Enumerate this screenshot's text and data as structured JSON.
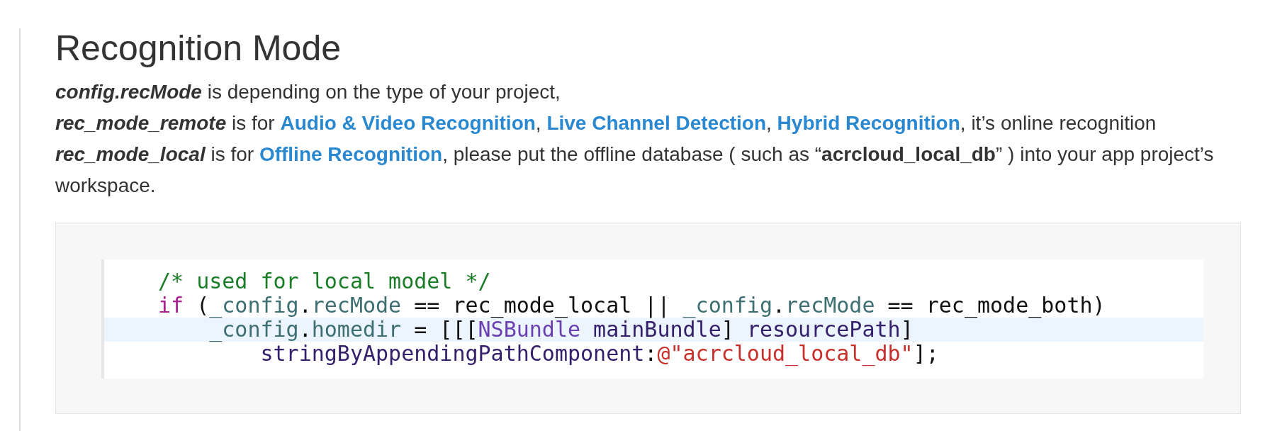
{
  "heading": "Recognition Mode",
  "paragraph_lines": [
    [
      {
        "kind": "term",
        "text": "config.recMode"
      },
      {
        "kind": "text",
        "text": " is depending on the type of your project,"
      }
    ],
    [
      {
        "kind": "term",
        "text": "rec_mode_remote"
      },
      {
        "kind": "text",
        "text": " is for "
      },
      {
        "kind": "link",
        "text": "Audio & Video Recognition",
        "after": ", "
      },
      {
        "kind": "link",
        "text": "Live Channel Detection",
        "after": ", "
      },
      {
        "kind": "link",
        "text": "Hybrid Recognition"
      },
      {
        "kind": "text",
        "text": ", it’s online recognition"
      }
    ],
    [
      {
        "kind": "term",
        "text": "rec_mode_local"
      },
      {
        "kind": "text",
        "text": "  is for "
      },
      {
        "kind": "link",
        "text": "Offline Recognition"
      },
      {
        "kind": "text",
        "text": ", please put the offline database ( such as “**acrcloud_local_db**” ) into your app project’s workspace."
      }
    ]
  ],
  "code_lines": [
    {
      "highlighted": false,
      "tokens": [
        {
          "kind": "comment",
          "text": "/* used for local model */"
        }
      ]
    },
    {
      "highlighted": false,
      "tokens": [
        {
          "kind": "keyword",
          "text": "if"
        },
        {
          "kind": "plain",
          "text": " ("
        },
        {
          "kind": "ident",
          "text": "_config"
        },
        {
          "kind": "plain",
          "text": "."
        },
        {
          "kind": "ident",
          "text": "recMode"
        },
        {
          "kind": "plain",
          "text": " == rec_mode_local || "
        },
        {
          "kind": "ident",
          "text": "_config"
        },
        {
          "kind": "plain",
          "text": "."
        },
        {
          "kind": "ident",
          "text": "recMode"
        },
        {
          "kind": "plain",
          "text": " == rec_mode_both)"
        }
      ]
    },
    {
      "highlighted": true,
      "tokens": [
        {
          "kind": "ident",
          "text": "    _config"
        },
        {
          "kind": "plain",
          "text": "."
        },
        {
          "kind": "ident",
          "text": "homedir"
        },
        {
          "kind": "plain",
          "text": " = [[["
        },
        {
          "kind": "class",
          "text": "NSBundle"
        },
        {
          "kind": "method",
          "text": " mainBundle"
        },
        {
          "kind": "plain",
          "text": "] "
        },
        {
          "kind": "method",
          "text": "resourcePath"
        },
        {
          "kind": "plain",
          "text": "]"
        }
      ]
    },
    {
      "highlighted": false,
      "tokens": [
        {
          "kind": "method",
          "text": "        stringByAppendingPathComponent"
        },
        {
          "kind": "plain",
          "text": ":"
        },
        {
          "kind": "string",
          "text": "@\"acrcloud_local_db\""
        },
        {
          "kind": "plain",
          "text": "];"
        }
      ]
    }
  ]
}
